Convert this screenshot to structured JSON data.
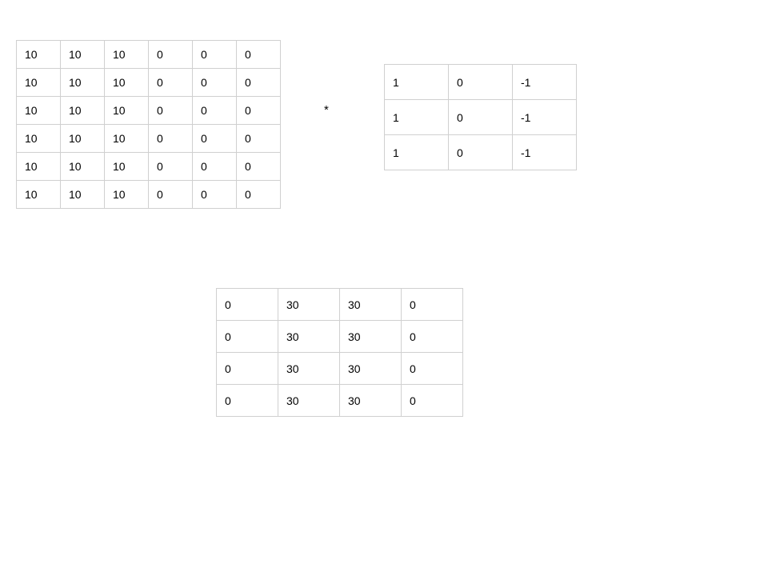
{
  "operator": "*",
  "input_matrix": {
    "rows": [
      [
        "10",
        "10",
        "10",
        "0",
        "0",
        "0"
      ],
      [
        "10",
        "10",
        "10",
        "0",
        "0",
        "0"
      ],
      [
        "10",
        "10",
        "10",
        "0",
        "0",
        "0"
      ],
      [
        "10",
        "10",
        "10",
        "0",
        "0",
        "0"
      ],
      [
        "10",
        "10",
        "10",
        "0",
        "0",
        "0"
      ],
      [
        "10",
        "10",
        "10",
        "0",
        "0",
        "0"
      ]
    ]
  },
  "kernel_matrix": {
    "rows": [
      [
        "1",
        "0",
        "-1"
      ],
      [
        "1",
        "0",
        "-1"
      ],
      [
        "1",
        "0",
        "-1"
      ]
    ]
  },
  "output_matrix": {
    "rows": [
      [
        "0",
        "30",
        "30",
        "0"
      ],
      [
        "0",
        "30",
        "30",
        "0"
      ],
      [
        "0",
        "30",
        "30",
        "0"
      ],
      [
        "0",
        "30",
        "30",
        "0"
      ]
    ]
  }
}
